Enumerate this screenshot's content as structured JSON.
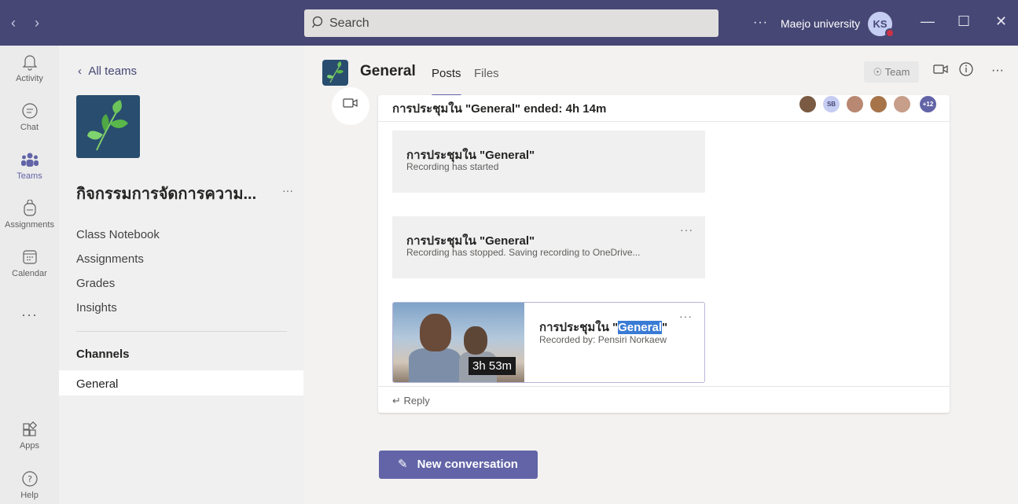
{
  "titlebar": {
    "search_placeholder": "Search",
    "more": "···",
    "org": "Maejo university",
    "avatar_initials": "KS",
    "status_color": "#cc3346"
  },
  "rail": {
    "items": [
      {
        "label": "Activity",
        "icon": "bell-icon"
      },
      {
        "label": "Chat",
        "icon": "chat-icon"
      },
      {
        "label": "Teams",
        "icon": "teams-icon"
      },
      {
        "label": "Assignments",
        "icon": "backpack-icon"
      },
      {
        "label": "Calendar",
        "icon": "calendar-icon"
      }
    ],
    "more": "···",
    "apps": "Apps",
    "help": "Help"
  },
  "teampanel": {
    "back": "All teams",
    "team_name": "กิจกรรมการจัดการความ...",
    "links": [
      "Class Notebook",
      "Assignments",
      "Grades",
      "Insights"
    ],
    "channels_heading": "Channels",
    "channel": "General"
  },
  "header": {
    "title": "General",
    "tabs": [
      "Posts",
      "Files"
    ],
    "team_button": "Team",
    "accent": "#6264a7"
  },
  "post": {
    "meeting_title": "การประชุมใน \"General\" ended: 4h 14m",
    "participants_more": "+12",
    "participant_initials": "SB",
    "cards": [
      {
        "title": "การประชุมใน \"General\"",
        "subtitle": "Recording has started"
      },
      {
        "title": "การประชุมใน \"General\"",
        "subtitle": "Recording has stopped. Saving recording to OneDrive..."
      }
    ],
    "recording": {
      "title_prefix": "การประชุมใน \"",
      "title_highlight": "General",
      "title_suffix": "\"",
      "subtitle": "Recorded by: Pensiri Norkaew",
      "duration": "3h 53m"
    },
    "reply": "Reply"
  },
  "new_conversation": "New conversation"
}
